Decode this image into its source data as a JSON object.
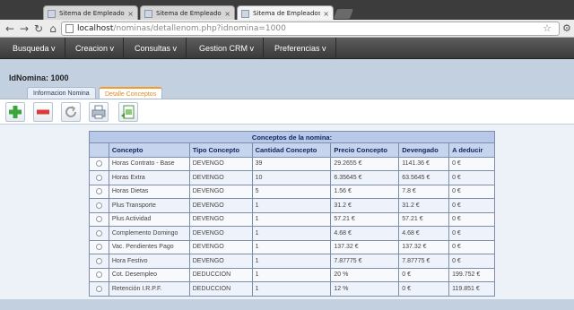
{
  "browser": {
    "tabs": [
      {
        "label": "Sitema de Empleados y Nó",
        "active": false
      },
      {
        "label": "Sitema de Empleados y Nó",
        "active": false
      },
      {
        "label": "Sitema de Empleados y Nó",
        "active": true
      }
    ],
    "url_host": "localhost",
    "url_path": "/nominas/detallenom.php?idnomina=1000"
  },
  "menu": {
    "items": [
      "Busqueda v",
      "Creacion v",
      "Consultas v",
      "Gestion CRM v",
      "Preferencias v"
    ]
  },
  "page": {
    "id_label": "IdNomina: 1000",
    "tabs": [
      "Informacion Nomina",
      "Detalle Conceptos"
    ],
    "active_tab": "Detalle Conceptos"
  },
  "actions": [
    {
      "icon": "add-icon",
      "color": "#3aa63a"
    },
    {
      "icon": "remove-icon",
      "color": "#d93b3b"
    },
    {
      "icon": "refresh-icon",
      "color": "#9a9a9a"
    },
    {
      "icon": "print-icon",
      "color": "#6f7f95"
    },
    {
      "icon": "export-icon",
      "color": "#4b9a3c"
    }
  ],
  "table": {
    "caption": "Conceptos de la nomina:",
    "headers": [
      "Concepto",
      "Tipo Concepto",
      "Cantidad Concepto",
      "Precio Concepto",
      "Devengado",
      "A deducir"
    ],
    "rows": [
      [
        "Horas Contrato - Base",
        "DEVENGO",
        "39",
        "29.2655 €",
        "1141.36 €",
        "0 €"
      ],
      [
        "Horas Extra",
        "DEVENGO",
        "10",
        "6.35645 €",
        "63.5645 €",
        "0 €"
      ],
      [
        "Horas Dietas",
        "DEVENGO",
        "5",
        "1.56 €",
        "7.8 €",
        "0 €"
      ],
      [
        "Plus Transporte",
        "DEVENGO",
        "1",
        "31.2 €",
        "31.2 €",
        "0 €"
      ],
      [
        "Plus Actividad",
        "DEVENGO",
        "1",
        "57.21 €",
        "57.21 €",
        "0 €"
      ],
      [
        "Complemento Domingo",
        "DEVENGO",
        "1",
        "4.68 €",
        "4.68 €",
        "0 €"
      ],
      [
        "Vac. Pendientes Pago",
        "DEVENGO",
        "1",
        "137.32 €",
        "137.32 €",
        "0 €"
      ],
      [
        "Hora Festivo",
        "DEVENGO",
        "1",
        "7.87775 €",
        "7.87775 €",
        "0 €"
      ],
      [
        "Cot. Desempleo",
        "DEDUCCION",
        "1",
        "20 %",
        "0 €",
        "199.752 €"
      ],
      [
        "Retención I.R.P.F.",
        "DEDUCCION",
        "1",
        "12 %",
        "0 €",
        "119.851 €"
      ]
    ]
  }
}
